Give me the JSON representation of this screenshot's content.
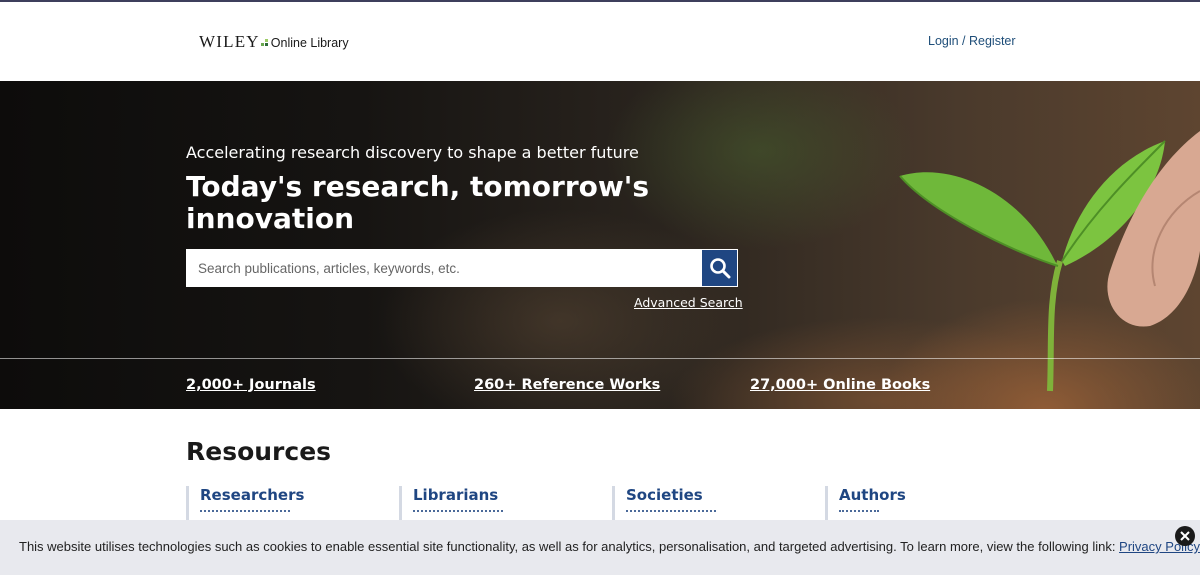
{
  "header": {
    "logo_brand": "WILEY",
    "logo_product": "Online Library",
    "login_label": "Login / Register"
  },
  "hero": {
    "tagline": "Accelerating research discovery to shape a better future",
    "headline": "Today's research, tomorrow's innovation",
    "search_placeholder": "Search publications, articles, keywords, etc.",
    "search_icon": "search-icon",
    "advanced_search_label": "Advanced Search",
    "stats": [
      {
        "label": "2,000+ Journals"
      },
      {
        "label": "260+ Reference Works"
      },
      {
        "label": "27,000+ Online Books"
      }
    ]
  },
  "resources": {
    "title": "Resources",
    "columns": [
      {
        "label": "Researchers"
      },
      {
        "label": "Librarians"
      },
      {
        "label": "Societies"
      },
      {
        "label": "Authors"
      }
    ]
  },
  "cookie_banner": {
    "text": "This website utilises technologies such as cookies to enable essential site functionality, as well as for analytics, personalisation, and targeted advertising. To learn more, view the following link: ",
    "link_label": "Privacy Policy",
    "close_icon": "close-icon"
  },
  "colors": {
    "brand_blue": "#1f4682",
    "link_blue": "#1f4e79",
    "banner_bg": "#e8e9ee"
  }
}
